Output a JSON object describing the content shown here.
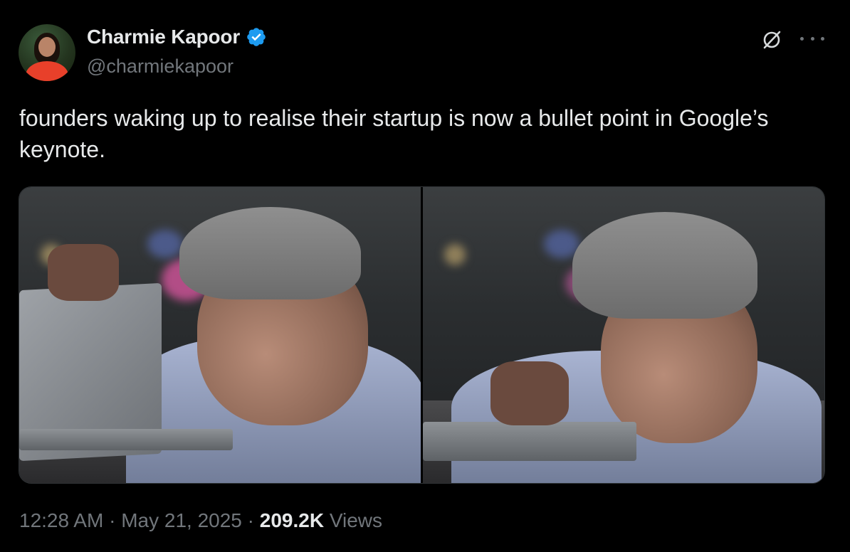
{
  "author": {
    "display_name": "Charmie Kapoor",
    "handle": "@charmiekapoor",
    "verified": true,
    "verified_color": "#1d9bf0"
  },
  "header_actions": {
    "grok_icon": "grok-icon",
    "more_icon": "more-icon"
  },
  "tweet": {
    "text": "founders waking up to realise their startup is now a bullet point in Google’s keynote."
  },
  "media": {
    "count": 2
  },
  "meta": {
    "time": "12:28 AM",
    "sep1": " · ",
    "date": "May 21, 2025",
    "sep2": " · ",
    "views_count": "209.2K",
    "views_label": " Views"
  },
  "colors": {
    "background": "#000000",
    "text_primary": "#e7e9ea",
    "text_secondary": "#71767b",
    "border": "#2f3336"
  }
}
